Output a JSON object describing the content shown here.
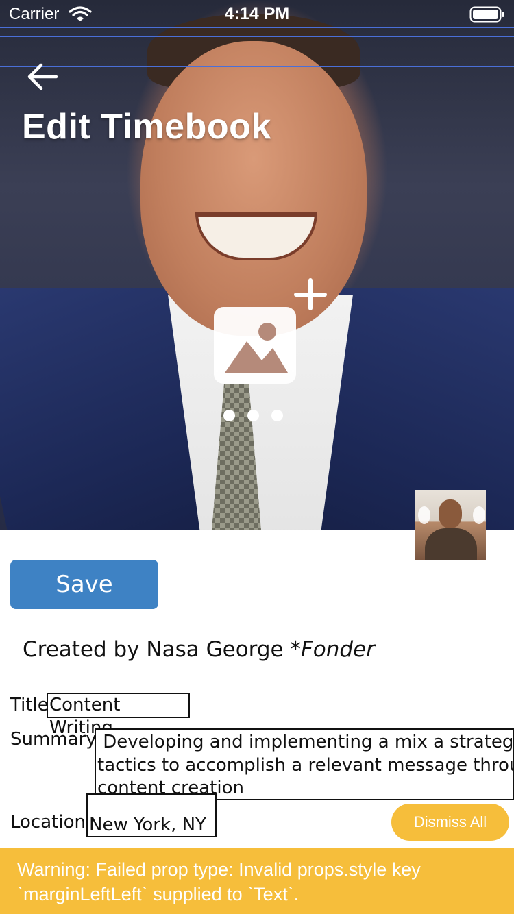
{
  "status_bar": {
    "carrier": "Carrier",
    "time": "4:14 PM",
    "wifi_icon": "wifi-icon",
    "battery_icon": "battery-full-icon"
  },
  "header": {
    "back_icon": "arrow-left-icon",
    "title": "Edit Timebook"
  },
  "hero": {
    "add_photo_icon": "image-add-icon",
    "more_icon": "more-horizontal-icon",
    "avatar": "user-avatar-photo"
  },
  "actions": {
    "save_label": "Save"
  },
  "creator": {
    "prefix": "Created by Nasa George ",
    "role": "*Fonder"
  },
  "form": {
    "title_label": "Title",
    "title_value": "Content Writing",
    "summary_label": "Summary",
    "summary_value": " Developing and implementing a mix a strategies and\ntactics to accomplish a relevant message through\ncontent creation",
    "location_label": "Location",
    "location_value": "New York, NY"
  },
  "warnings": {
    "dismiss_label": "Dismiss All",
    "message": "Warning: Failed prop type: Invalid props.style key\n`marginLeftLeft` supplied to `Text`."
  },
  "colors": {
    "save_button": "#3e82c4",
    "warning": "#f6be3b"
  }
}
